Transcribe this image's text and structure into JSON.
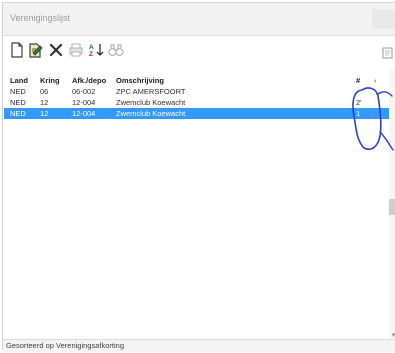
{
  "window": {
    "title": "Verenigingslijst"
  },
  "toolbar": {
    "buttons": [
      {
        "name": "new-document-icon"
      },
      {
        "name": "edit-document-icon"
      },
      {
        "name": "delete-x-icon"
      },
      {
        "name": "print-icon"
      },
      {
        "name": "sort-az-icon"
      },
      {
        "name": "binoculars-search-icon"
      }
    ],
    "right_button": {
      "name": "page-icon"
    }
  },
  "table": {
    "headers": {
      "land": "Land",
      "kring": "Kring",
      "afk": "Afk./depo",
      "omschrijving": "Omschrijving",
      "hash": "#",
      "more": "‹"
    },
    "rows": [
      {
        "land": "NED",
        "kring": "06",
        "afk": "06-002",
        "omschrijving": "ZPC AMERSFOORT",
        "hash": "",
        "selected": false
      },
      {
        "land": "NED",
        "kring": "12",
        "afk": "12-004",
        "omschrijving": "Zwemclub Koewacht",
        "hash": "2'",
        "selected": false
      },
      {
        "land": "NED",
        "kring": "12",
        "afk": "12-004",
        "omschrijving": "Zwemclub Koewacht",
        "hash": "1",
        "selected": true
      }
    ]
  },
  "status": {
    "text": "Gesorteerd op Verenigingsafkorting"
  },
  "colors": {
    "selection": "#3399ff",
    "annotation": "#2a3fd6"
  }
}
